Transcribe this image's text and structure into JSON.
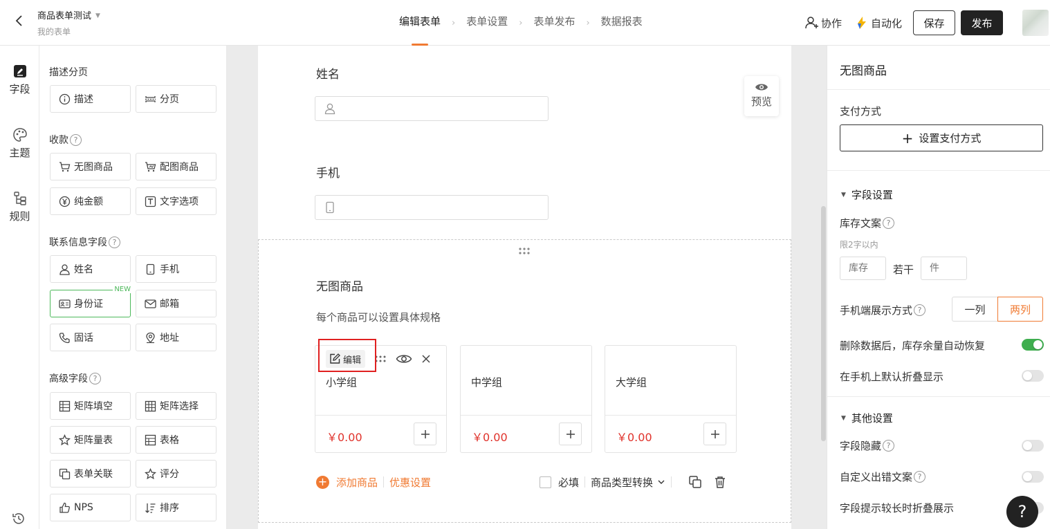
{
  "header": {
    "form_title": "商品表单测试",
    "form_subtitle": "我的表单",
    "steps": [
      {
        "label": "编辑表单",
        "active": true
      },
      {
        "label": "表单设置",
        "active": false
      },
      {
        "label": "表单发布",
        "active": false
      },
      {
        "label": "数据报表",
        "active": false
      }
    ],
    "step_separator": "›",
    "collab_label": "协作",
    "auto_label": "自动化",
    "save_label": "保存",
    "publish_label": "发布"
  },
  "rail": {
    "items": [
      {
        "label": "字段",
        "icon": "edit-doc-icon"
      },
      {
        "label": "主题",
        "icon": "palette-icon"
      },
      {
        "label": "规则",
        "icon": "rules-icon"
      }
    ],
    "history_icon": "history-icon"
  },
  "palette": {
    "groups": {
      "describe": {
        "title": "描述分页",
        "items": [
          "描述",
          "分页"
        ]
      },
      "payment": {
        "title": "收款",
        "items": [
          "无图商品",
          "配图商品",
          "纯金额",
          "文字选项"
        ]
      },
      "contact": {
        "title": "联系信息字段",
        "items": [
          "姓名",
          "手机",
          "身份证",
          "邮箱",
          "固话",
          "地址"
        ],
        "new_badge": "NEW"
      },
      "advanced": {
        "title": "高级字段",
        "items": [
          "矩阵填空",
          "矩阵选择",
          "矩阵量表",
          "表格",
          "表单关联",
          "评分",
          "NPS",
          "排序"
        ]
      }
    }
  },
  "canvas": {
    "fields": [
      {
        "label": "姓名",
        "icon": "person-icon"
      },
      {
        "label": "手机",
        "icon": "phone-icon"
      }
    ],
    "preview_label": "预览",
    "selected": {
      "title": "无图商品",
      "description": "每个商品可以设置具体规格",
      "products": [
        {
          "name": "小学组",
          "price": "￥0.00"
        },
        {
          "name": "中学组",
          "price": "￥0.00"
        },
        {
          "name": "大学组",
          "price": "￥0.00"
        }
      ],
      "edit_label": "编辑",
      "add_product_label": "添加商品",
      "discount_label": "优惠设置",
      "required_label": "必填",
      "type_switch_label": "商品类型转换"
    }
  },
  "settings": {
    "title": "无图商品",
    "pay_method_label": "支付方式",
    "set_pay_button": "设置支付方式",
    "field_section": "字段设置",
    "stock_text_label": "库存文案",
    "stock_hint": "限2字以内",
    "stock_placeholder": "库存",
    "ruogan": "若干",
    "unit_placeholder": "件",
    "mobile_display_label": "手机端展示方式",
    "display_options": [
      "一列",
      "两列"
    ],
    "display_selected": "两列",
    "restore_stock_label": "删除数据后，库存余量自动恢复",
    "restore_stock_on": true,
    "mobile_fold_label": "在手机上默认折叠显示",
    "mobile_fold_on": false,
    "other_section": "其他设置",
    "hide_field_label": "字段隐藏",
    "hide_field_on": false,
    "custom_error_label": "自定义出错文案",
    "custom_error_on": false,
    "long_hint_fold_label": "字段提示较长时折叠展示",
    "long_hint_fold_on": false
  },
  "help_label": "?",
  "colors": {
    "accent": "#f07a32",
    "price": "#e0322b",
    "toggle_on": "#3fae4f",
    "dark_button": "#222222",
    "new_badge": "#4cb85a"
  }
}
